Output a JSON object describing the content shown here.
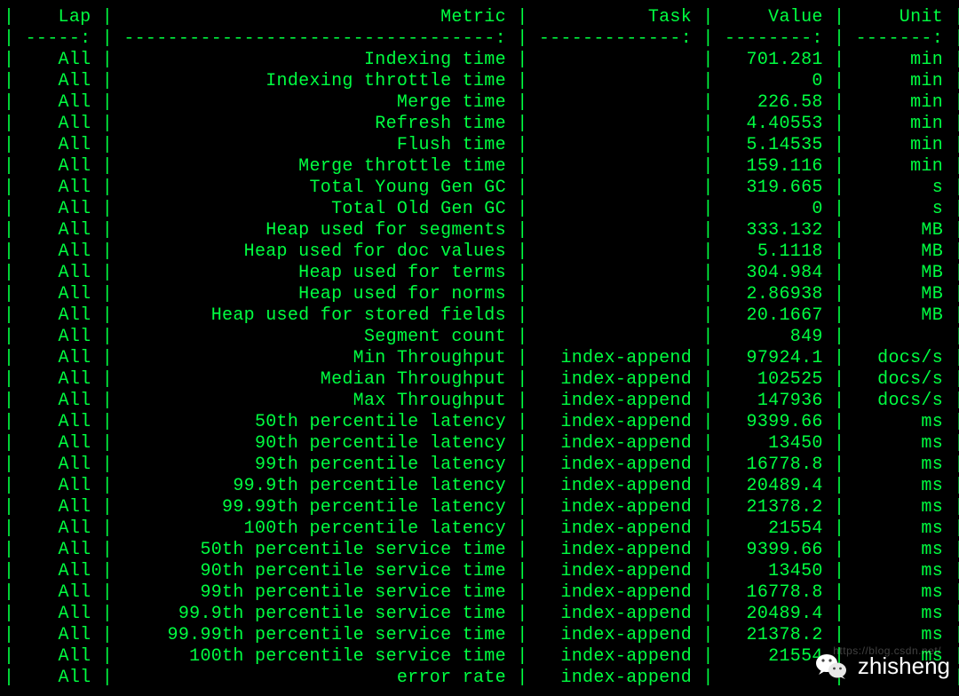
{
  "table": {
    "headers": {
      "lap": "Lap",
      "metric": "Metric",
      "task": "Task",
      "value": "Value",
      "unit": "Unit"
    },
    "rows": [
      {
        "lap": "All",
        "metric": "Indexing time",
        "task": "",
        "value": "701.281",
        "unit": "min"
      },
      {
        "lap": "All",
        "metric": "Indexing throttle time",
        "task": "",
        "value": "0",
        "unit": "min"
      },
      {
        "lap": "All",
        "metric": "Merge time",
        "task": "",
        "value": "226.58",
        "unit": "min"
      },
      {
        "lap": "All",
        "metric": "Refresh time",
        "task": "",
        "value": "4.40553",
        "unit": "min"
      },
      {
        "lap": "All",
        "metric": "Flush time",
        "task": "",
        "value": "5.14535",
        "unit": "min"
      },
      {
        "lap": "All",
        "metric": "Merge throttle time",
        "task": "",
        "value": "159.116",
        "unit": "min"
      },
      {
        "lap": "All",
        "metric": "Total Young Gen GC",
        "task": "",
        "value": "319.665",
        "unit": "s"
      },
      {
        "lap": "All",
        "metric": "Total Old Gen GC",
        "task": "",
        "value": "0",
        "unit": "s"
      },
      {
        "lap": "All",
        "metric": "Heap used for segments",
        "task": "",
        "value": "333.132",
        "unit": "MB"
      },
      {
        "lap": "All",
        "metric": "Heap used for doc values",
        "task": "",
        "value": "5.1118",
        "unit": "MB"
      },
      {
        "lap": "All",
        "metric": "Heap used for terms",
        "task": "",
        "value": "304.984",
        "unit": "MB"
      },
      {
        "lap": "All",
        "metric": "Heap used for norms",
        "task": "",
        "value": "2.86938",
        "unit": "MB"
      },
      {
        "lap": "All",
        "metric": "Heap used for stored fields",
        "task": "",
        "value": "20.1667",
        "unit": "MB"
      },
      {
        "lap": "All",
        "metric": "Segment count",
        "task": "",
        "value": "849",
        "unit": ""
      },
      {
        "lap": "All",
        "metric": "Min Throughput",
        "task": "index-append",
        "value": "97924.1",
        "unit": "docs/s"
      },
      {
        "lap": "All",
        "metric": "Median Throughput",
        "task": "index-append",
        "value": "102525",
        "unit": "docs/s"
      },
      {
        "lap": "All",
        "metric": "Max Throughput",
        "task": "index-append",
        "value": "147936",
        "unit": "docs/s"
      },
      {
        "lap": "All",
        "metric": "50th percentile latency",
        "task": "index-append",
        "value": "9399.66",
        "unit": "ms"
      },
      {
        "lap": "All",
        "metric": "90th percentile latency",
        "task": "index-append",
        "value": "13450",
        "unit": "ms"
      },
      {
        "lap": "All",
        "metric": "99th percentile latency",
        "task": "index-append",
        "value": "16778.8",
        "unit": "ms"
      },
      {
        "lap": "All",
        "metric": "99.9th percentile latency",
        "task": "index-append",
        "value": "20489.4",
        "unit": "ms"
      },
      {
        "lap": "All",
        "metric": "99.99th percentile latency",
        "task": "index-append",
        "value": "21378.2",
        "unit": "ms"
      },
      {
        "lap": "All",
        "metric": "100th percentile latency",
        "task": "index-append",
        "value": "21554",
        "unit": "ms"
      },
      {
        "lap": "All",
        "metric": "50th percentile service time",
        "task": "index-append",
        "value": "9399.66",
        "unit": "ms"
      },
      {
        "lap": "All",
        "metric": "90th percentile service time",
        "task": "index-append",
        "value": "13450",
        "unit": "ms"
      },
      {
        "lap": "All",
        "metric": "99th percentile service time",
        "task": "index-append",
        "value": "16778.8",
        "unit": "ms"
      },
      {
        "lap": "All",
        "metric": "99.9th percentile service time",
        "task": "index-append",
        "value": "20489.4",
        "unit": "ms"
      },
      {
        "lap": "All",
        "metric": "99.99th percentile service time",
        "task": "index-append",
        "value": "21378.2",
        "unit": "ms"
      },
      {
        "lap": "All",
        "metric": "100th percentile service time",
        "task": "index-append",
        "value": "21554",
        "unit": "ms"
      },
      {
        "lap": "All",
        "metric": "error rate",
        "task": "index-append",
        "value": "",
        "unit": ""
      }
    ]
  },
  "overlay": {
    "label": "zhisheng",
    "icon_name": "wechat-icon"
  },
  "watermark": {
    "text": "https://blog.csdn.net/"
  },
  "layout": {
    "cols": {
      "lap": 6,
      "metric": 35,
      "task": 14,
      "value": 9,
      "unit": 8
    },
    "sep": " | "
  }
}
